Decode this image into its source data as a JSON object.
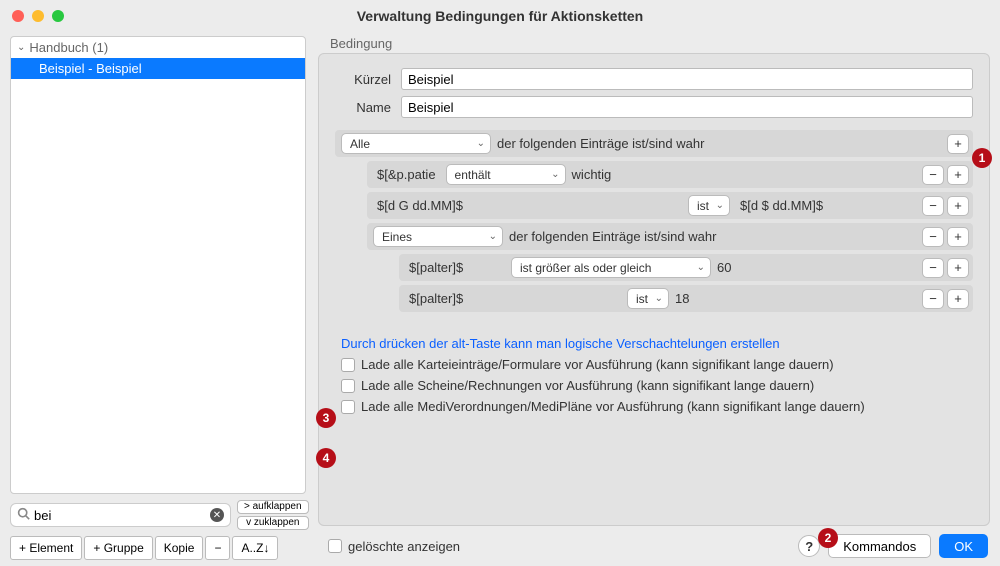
{
  "window": {
    "title": "Verwaltung Bedingungen für Aktionsketten"
  },
  "tree": {
    "group_label": "Handbuch (1)",
    "selected_item": "Beispiel - Beispiel"
  },
  "search": {
    "value": "bei",
    "expand_label": "> aufklappen",
    "collapse_label": "v zuklappen"
  },
  "toolbar": {
    "add_element": "+ Element",
    "add_group": "+ Gruppe",
    "copy": "Kopie",
    "remove": "−",
    "sort": "A..Z↓"
  },
  "condition": {
    "section_label": "Bedingung",
    "kuerzel_label": "Kürzel",
    "kuerzel_value": "Beispiel",
    "name_label": "Name",
    "name_value": "Beispiel",
    "group_op1": "Alle",
    "group_text": "der folgenden Einträge ist/sind wahr",
    "rule1_var": "$[&p.patie",
    "rule1_op": "enthält",
    "rule1_val": "wichtig",
    "rule2_var": "$[d G dd.MM]$",
    "rule2_op": "ist",
    "rule2_val": "$[d $ dd.MM]$",
    "group_op2": "Eines",
    "rule3_var": "$[palter]$",
    "rule3_op": "ist größer als oder gleich",
    "rule3_val": "60",
    "rule4_var": "$[palter]$",
    "rule4_op": "ist",
    "rule4_val": "18",
    "hint": "Durch drücken der alt-Taste kann man logische Verschachtelungen erstellen",
    "cb1": "Lade alle Karteieinträge/Formulare vor Ausführung (kann signifikant lange dauern)",
    "cb2": "Lade alle Scheine/Rechnungen vor Ausführung (kann signifikant lange dauern)",
    "cb3": "Lade alle MediVerordnungen/MediPläne vor Ausführung (kann signifikant lange dauern)"
  },
  "footer": {
    "show_deleted": "gelöschte anzeigen",
    "help": "?",
    "commands": "Kommandos",
    "ok": "OK"
  },
  "callouts": {
    "c1": "1",
    "c2": "2",
    "c3": "3",
    "c4": "4"
  }
}
